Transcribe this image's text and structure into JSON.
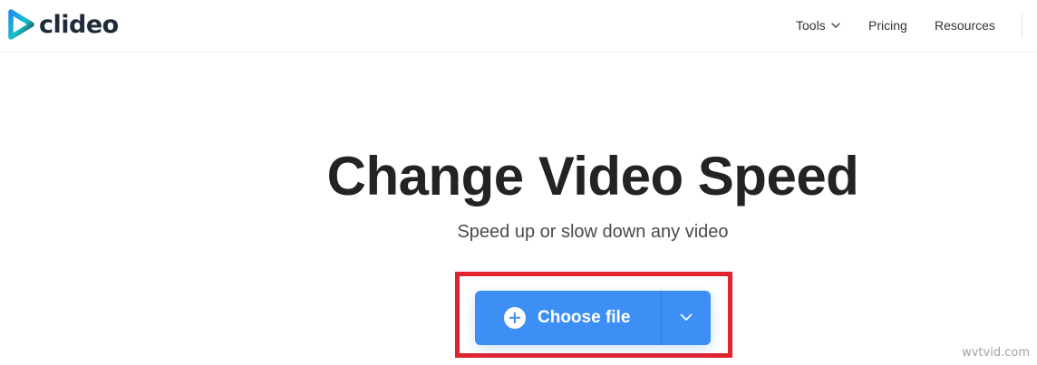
{
  "brand": {
    "name": "clideo",
    "logo_icon": "clideo-play-logo",
    "colors": {
      "cyan": "#16c0c7",
      "blue": "#3d8ff6",
      "dark": "#1f2a3a"
    }
  },
  "nav": {
    "tools": {
      "label": "Tools",
      "icon": "chevron-down-icon"
    },
    "pricing": {
      "label": "Pricing"
    },
    "resources": {
      "label": "Resources"
    }
  },
  "hero": {
    "title": "Change Video Speed",
    "subtitle": "Speed up or slow down any video"
  },
  "upload": {
    "choose_label": "Choose file",
    "choose_icon": "plus-circle-icon",
    "dropdown_icon": "chevron-down-icon",
    "button_color": "#3d8ff6",
    "highlight_color": "#e0242e"
  },
  "watermark": {
    "text": "wvtvid.com"
  }
}
